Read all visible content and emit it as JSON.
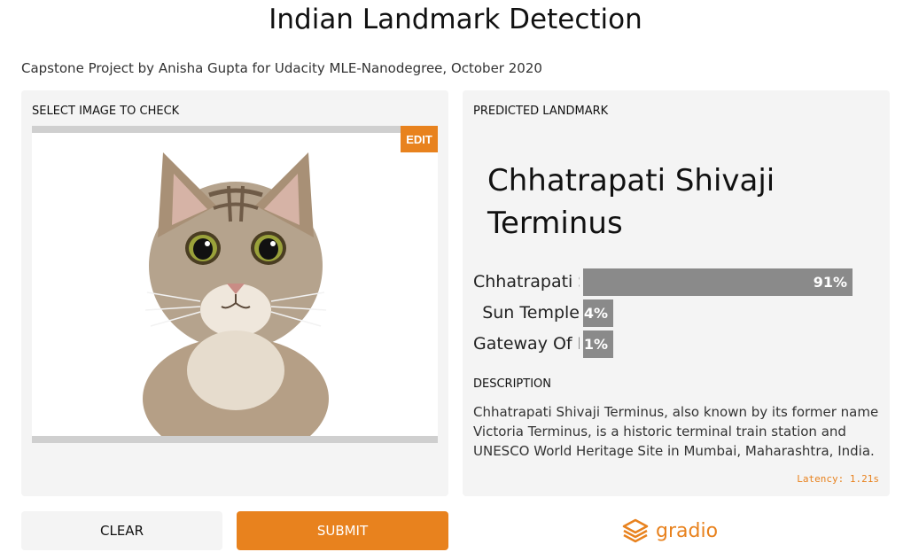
{
  "header": {
    "title": "Indian Landmark Detection",
    "subtitle": "Capstone Project by Anisha Gupta for Udacity MLE-Nanodegree, October 2020"
  },
  "input_panel": {
    "label": "SELECT IMAGE TO CHECK",
    "edit_label": "EDIT"
  },
  "output_panel": {
    "label": "PREDICTED LANDMARK",
    "prediction": "Chhatrapati Shivaji Terminus",
    "confidences": [
      {
        "label": "Chhatrapati Shivaji Terminus",
        "percent_text": "91%",
        "value": 0.91
      },
      {
        "label": "Sun Temple",
        "percent_text": "4%",
        "value": 0.04
      },
      {
        "label": "Gateway Of India",
        "percent_text": "1%",
        "value": 0.01
      }
    ],
    "description_label": "DESCRIPTION",
    "description": "Chhatrapati Shivaji Terminus, also known by its former name Victoria Terminus, is a historic terminal train station and UNESCO World Heritage Site in Mumbai, Maharashtra, India.",
    "latency": "Latency: 1.21s"
  },
  "actions": {
    "clear_label": "CLEAR",
    "submit_label": "SUBMIT"
  },
  "brand": {
    "name": "gradio",
    "accent_color": "#e8821e"
  }
}
